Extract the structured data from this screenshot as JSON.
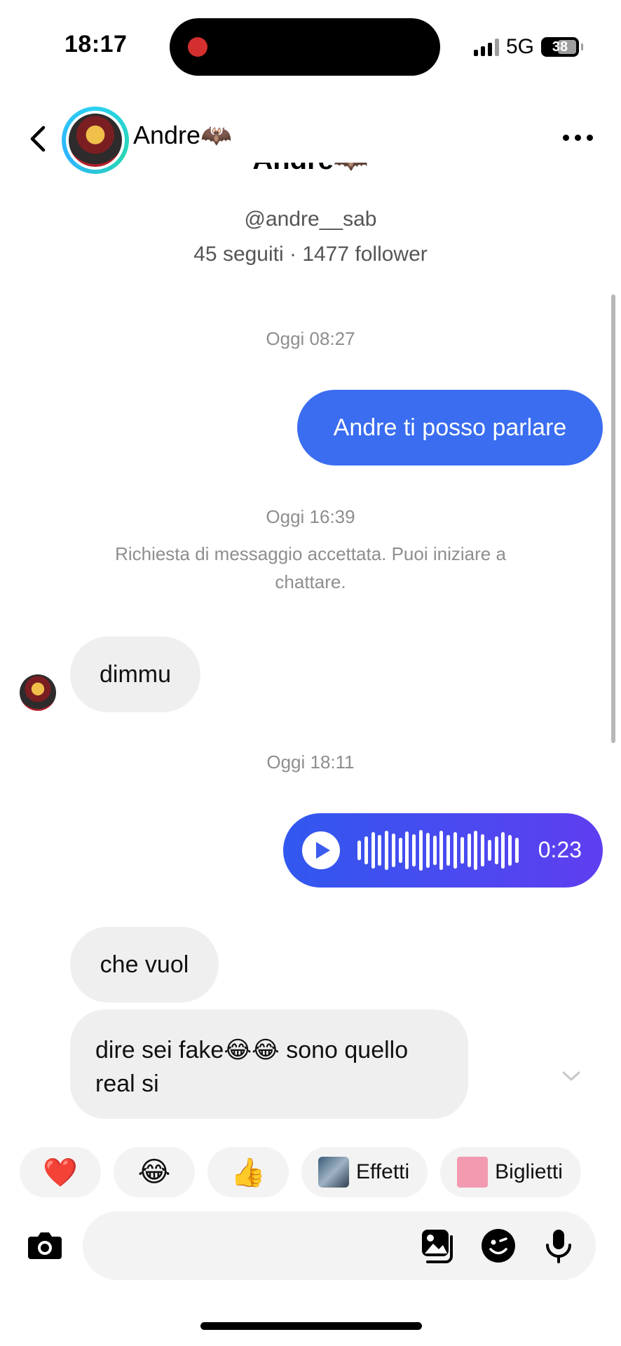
{
  "status_bar": {
    "time": "18:17",
    "network": "5G",
    "battery": "38"
  },
  "header": {
    "name": "Andre🦇",
    "back_icon": "chevron-left-icon",
    "more_icon": "more-horizontal-icon"
  },
  "profile": {
    "name": "Andre🦇",
    "handle": "@andre__sab",
    "stats": "45 seguiti · 1477 follower"
  },
  "messages": {
    "ts1": "Oggi 08:27",
    "out1": "Andre ti posso parlare",
    "ts2": "Oggi 16:39",
    "system": "Richiesta di messaggio accettata. Puoi iniziare a chattare.",
    "in1": "dimmu",
    "ts3": "Oggi 18:11",
    "voice_duration": "0:23",
    "in2": "che vuol",
    "in3": "dire sei fake😂😂 sono quello real si"
  },
  "reactions": [
    {
      "label": "❤️"
    },
    {
      "label": "😂"
    },
    {
      "label": "👍"
    },
    {
      "label": "Effetti"
    },
    {
      "label": "Biglietti"
    }
  ],
  "composer": {
    "placeholder": ""
  },
  "colors": {
    "outgoing": "#3a6df0",
    "voice_start": "#3158ef",
    "voice_end": "#5f3ef0",
    "incoming": "#efefef"
  }
}
